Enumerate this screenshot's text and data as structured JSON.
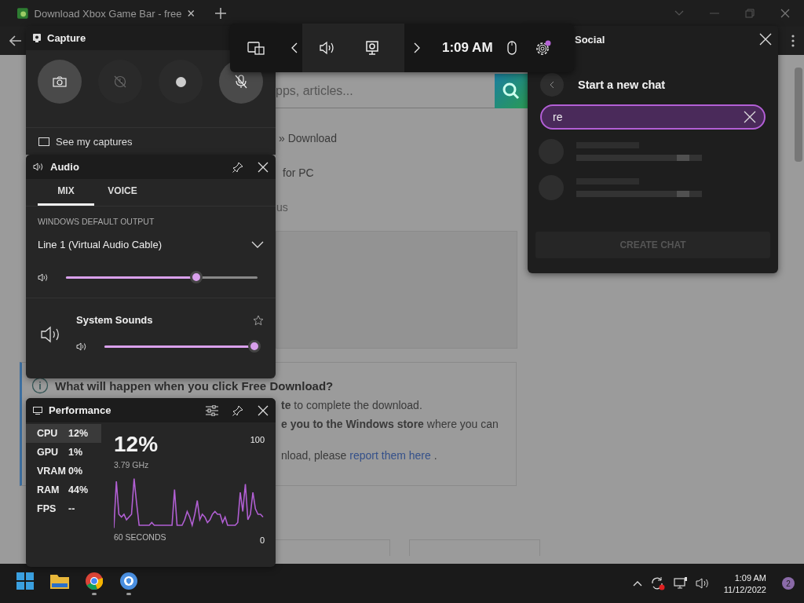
{
  "browser": {
    "tab_title": "Download Xbox Game Bar - free",
    "page": {
      "search_placeholder": "pps, articles...",
      "breadcrumb": "» Download",
      "subtitle": "for PC",
      "status_fragment": "us",
      "info_heading": "What will happen when you click Free Download?",
      "info_lines": [
        "**te** to complete the download.",
        "**e you to the Windows store** where you can"
      ],
      "report_text": "nload, please",
      "report_link": "report them here",
      "report_end": "."
    }
  },
  "game_bar": {
    "time": "1:09 AM",
    "settings_notification": true
  },
  "capture": {
    "title": "Capture",
    "buttons": [
      {
        "kind": "screenshot",
        "disabled": false
      },
      {
        "kind": "record_last",
        "disabled": true
      },
      {
        "kind": "record",
        "disabled": false
      },
      {
        "kind": "mic_off",
        "disabled": false
      }
    ],
    "link": "See my captures"
  },
  "audio": {
    "title": "Audio",
    "tabs": [
      {
        "label": "MIX",
        "selected": true
      },
      {
        "label": "VOICE",
        "selected": false
      }
    ],
    "output_label": "WINDOWS DEFAULT OUTPUT",
    "device": "Line 1 (Virtual Audio Cable)",
    "level": 0.68,
    "apps": [
      {
        "name": "System Sounds",
        "favorite": false,
        "level": 1
      }
    ]
  },
  "performance": {
    "title": "Performance",
    "metrics": [
      {
        "name": "CPU",
        "value": "12%",
        "selected": true
      },
      {
        "name": "GPU",
        "value": "1%",
        "selected": false
      },
      {
        "name": "VRAM",
        "value": "0%",
        "selected": false
      },
      {
        "name": "RAM",
        "value": "44%",
        "selected": false
      },
      {
        "name": "FPS",
        "value": "--",
        "selected": false
      }
    ],
    "big_value": "12%",
    "detail": "3.79 GHz",
    "y_max": "100",
    "y_min": "0",
    "x_label": "60 SECONDS"
  },
  "social": {
    "title": "Social",
    "heading": "Start a new chat",
    "search_value": "re",
    "create_button": {
      "label": "CREATE CHAT",
      "disabled": true
    }
  },
  "taskbar": {
    "apps": [
      {
        "kind": "start",
        "running": false
      },
      {
        "kind": "explorer",
        "running": false
      },
      {
        "kind": "chrome",
        "running": true
      },
      {
        "kind": "browser",
        "running": true
      }
    ],
    "time": "1:09 AM",
    "date": "11/12/2022",
    "notifications": "2"
  }
}
